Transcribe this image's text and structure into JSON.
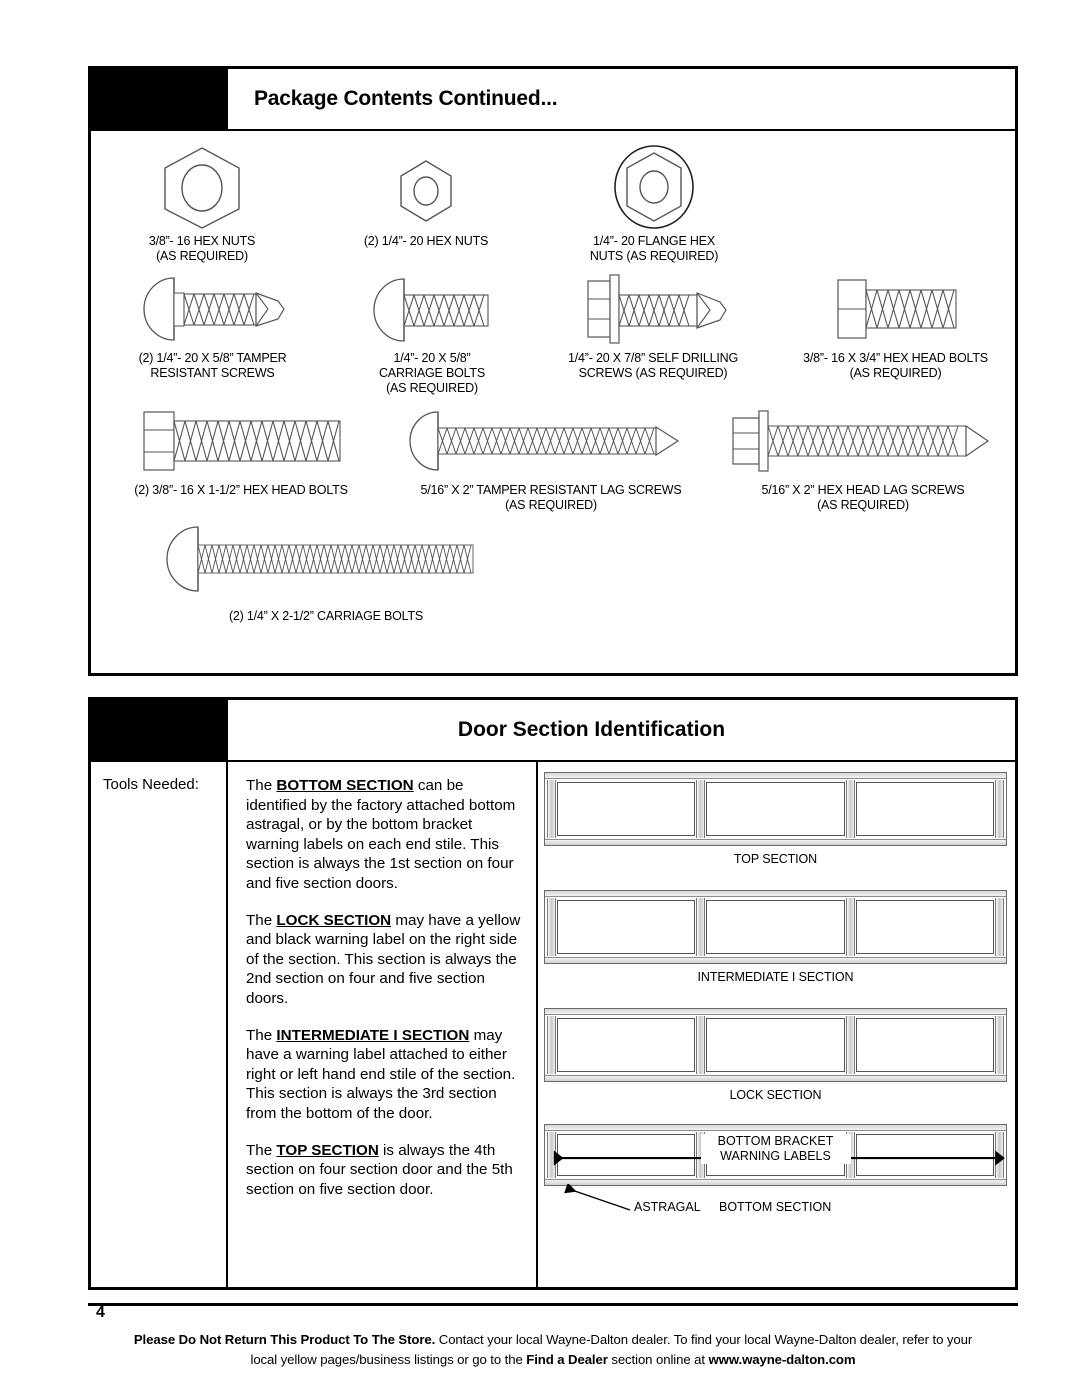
{
  "package_panel": {
    "title": "Package Contents Continued...",
    "rows": [
      {
        "items": [
          {
            "art": "hex-nut",
            "label": "3/8”- 16 HEX NUTS\n(AS REQUIRED)"
          },
          {
            "art": "hex-nut-small",
            "label": "(2) 1/4”- 20 HEX NUTS"
          },
          {
            "art": "flange-hex-nut",
            "label": "1/4”- 20 FLANGE HEX\nNUTS (AS REQUIRED)"
          }
        ]
      },
      {
        "items": [
          {
            "art": "tamper-resistant-screw",
            "label": "(2) 1/4”- 20 X 5/8” TAMPER\nRESISTANT SCREWS"
          },
          {
            "art": "carriage-bolt-short",
            "label": "1/4”- 20 X 5/8”\nCARRIAGE BOLTS\n(AS REQUIRED)"
          },
          {
            "art": "self-drilling-screw",
            "label": "1/4”- 20 X 7/8” SELF DRILLING\nSCREWS (AS REQUIRED)"
          },
          {
            "art": "hex-head-bolt-short",
            "label": "3/8”- 16 X 3/4” HEX HEAD BOLTS\n(AS REQUIRED)"
          }
        ]
      },
      {
        "items": [
          {
            "art": "hex-head-bolt-long",
            "label": "(2) 3/8”- 16 X 1-1/2” HEX HEAD BOLTS"
          },
          {
            "art": "tamper-resistant-lag-screw",
            "label": "5/16” X 2” TAMPER RESISTANT LAG SCREWS\n(AS REQUIRED)"
          },
          {
            "art": "hex-head-lag-screw",
            "label": "5/16” X 2” HEX HEAD LAG SCREWS\n(AS REQUIRED)"
          }
        ]
      },
      {
        "items": [
          {
            "art": "carriage-bolt-long",
            "label": "(2) 1/4” X 2-1/2” CARRIAGE BOLTS"
          }
        ]
      }
    ]
  },
  "door_panel": {
    "title": "Door Section Identification",
    "tools_label": "Tools Needed:",
    "paragraphs": [
      {
        "lead": "The ",
        "term": "BOTTOM SECTION",
        "rest": " can be identified by the factory attached bottom astragal, or by the bottom bracket warning labels on each end stile. This section is always the 1st section on four and five section doors."
      },
      {
        "lead": "The ",
        "term": "LOCK SECTION",
        "rest": " may have a yellow and black warning label on the right side of the section. This section is always the 2nd section on four and five section doors."
      },
      {
        "lead": "The ",
        "term": "INTERMEDIATE I SECTION",
        "rest": " may have a warning label attached to either right or left hand end stile of the section. This section is always the 3rd section from the bottom of the door."
      },
      {
        "lead": "The ",
        "term": "TOP SECTION",
        "rest": "  is always the 4th section on four section door and the 5th section on five section door."
      }
    ],
    "diagram": {
      "sections": [
        {
          "label": "TOP SECTION"
        },
        {
          "label": "INTERMEDIATE I SECTION"
        },
        {
          "label": "LOCK SECTION"
        }
      ],
      "bottom_section": {
        "callout": "BOTTOM BRACKET\nWARNING LABELS",
        "astragal_label": "ASTRAGAL",
        "label": "BOTTOM SECTION"
      }
    }
  },
  "footer": {
    "page_number": "4",
    "line1_bold": "Please Do Not Return This Product To The Store.",
    "line1_rest": " Contact your local Wayne-Dalton dealer. To find your local Wayne-Dalton dealer, refer to your",
    "line2_pre": "local yellow pages/business listings or go to the ",
    "line2_bold": "Find a Dealer",
    "line2_mid": " section online at ",
    "line2_url": "www.wayne-dalton.com"
  }
}
